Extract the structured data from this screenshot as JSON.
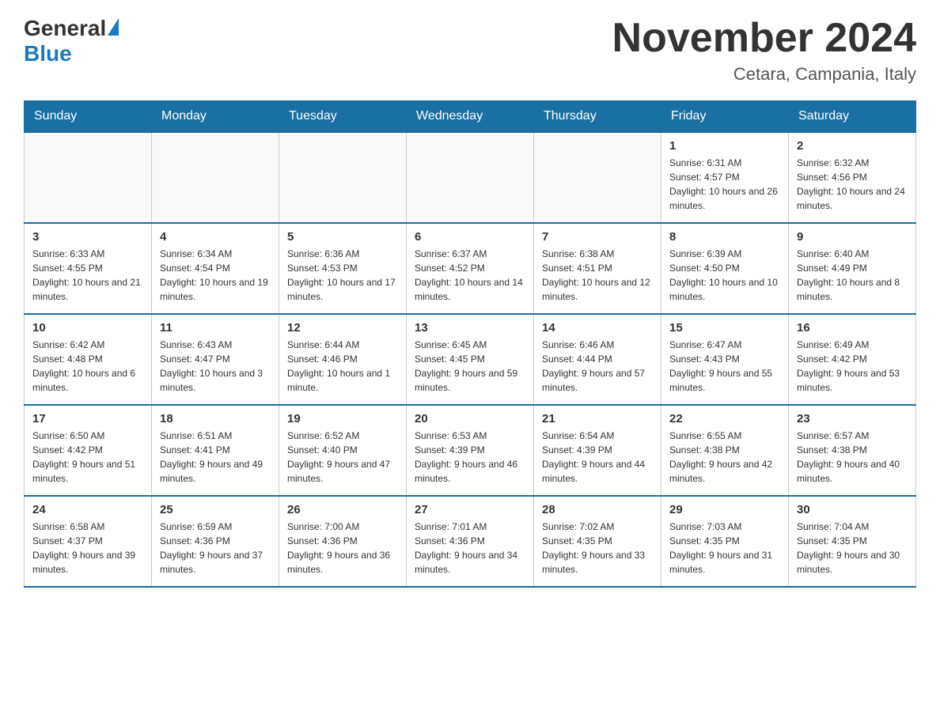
{
  "header": {
    "logo_general": "General",
    "logo_blue": "Blue",
    "month_title": "November 2024",
    "location": "Cetara, Campania, Italy"
  },
  "days_of_week": [
    "Sunday",
    "Monday",
    "Tuesday",
    "Wednesday",
    "Thursday",
    "Friday",
    "Saturday"
  ],
  "weeks": [
    [
      {
        "day": "",
        "info": ""
      },
      {
        "day": "",
        "info": ""
      },
      {
        "day": "",
        "info": ""
      },
      {
        "day": "",
        "info": ""
      },
      {
        "day": "",
        "info": ""
      },
      {
        "day": "1",
        "info": "Sunrise: 6:31 AM\nSunset: 4:57 PM\nDaylight: 10 hours and 26 minutes."
      },
      {
        "day": "2",
        "info": "Sunrise: 6:32 AM\nSunset: 4:56 PM\nDaylight: 10 hours and 24 minutes."
      }
    ],
    [
      {
        "day": "3",
        "info": "Sunrise: 6:33 AM\nSunset: 4:55 PM\nDaylight: 10 hours and 21 minutes."
      },
      {
        "day": "4",
        "info": "Sunrise: 6:34 AM\nSunset: 4:54 PM\nDaylight: 10 hours and 19 minutes."
      },
      {
        "day": "5",
        "info": "Sunrise: 6:36 AM\nSunset: 4:53 PM\nDaylight: 10 hours and 17 minutes."
      },
      {
        "day": "6",
        "info": "Sunrise: 6:37 AM\nSunset: 4:52 PM\nDaylight: 10 hours and 14 minutes."
      },
      {
        "day": "7",
        "info": "Sunrise: 6:38 AM\nSunset: 4:51 PM\nDaylight: 10 hours and 12 minutes."
      },
      {
        "day": "8",
        "info": "Sunrise: 6:39 AM\nSunset: 4:50 PM\nDaylight: 10 hours and 10 minutes."
      },
      {
        "day": "9",
        "info": "Sunrise: 6:40 AM\nSunset: 4:49 PM\nDaylight: 10 hours and 8 minutes."
      }
    ],
    [
      {
        "day": "10",
        "info": "Sunrise: 6:42 AM\nSunset: 4:48 PM\nDaylight: 10 hours and 6 minutes."
      },
      {
        "day": "11",
        "info": "Sunrise: 6:43 AM\nSunset: 4:47 PM\nDaylight: 10 hours and 3 minutes."
      },
      {
        "day": "12",
        "info": "Sunrise: 6:44 AM\nSunset: 4:46 PM\nDaylight: 10 hours and 1 minute."
      },
      {
        "day": "13",
        "info": "Sunrise: 6:45 AM\nSunset: 4:45 PM\nDaylight: 9 hours and 59 minutes."
      },
      {
        "day": "14",
        "info": "Sunrise: 6:46 AM\nSunset: 4:44 PM\nDaylight: 9 hours and 57 minutes."
      },
      {
        "day": "15",
        "info": "Sunrise: 6:47 AM\nSunset: 4:43 PM\nDaylight: 9 hours and 55 minutes."
      },
      {
        "day": "16",
        "info": "Sunrise: 6:49 AM\nSunset: 4:42 PM\nDaylight: 9 hours and 53 minutes."
      }
    ],
    [
      {
        "day": "17",
        "info": "Sunrise: 6:50 AM\nSunset: 4:42 PM\nDaylight: 9 hours and 51 minutes."
      },
      {
        "day": "18",
        "info": "Sunrise: 6:51 AM\nSunset: 4:41 PM\nDaylight: 9 hours and 49 minutes."
      },
      {
        "day": "19",
        "info": "Sunrise: 6:52 AM\nSunset: 4:40 PM\nDaylight: 9 hours and 47 minutes."
      },
      {
        "day": "20",
        "info": "Sunrise: 6:53 AM\nSunset: 4:39 PM\nDaylight: 9 hours and 46 minutes."
      },
      {
        "day": "21",
        "info": "Sunrise: 6:54 AM\nSunset: 4:39 PM\nDaylight: 9 hours and 44 minutes."
      },
      {
        "day": "22",
        "info": "Sunrise: 6:55 AM\nSunset: 4:38 PM\nDaylight: 9 hours and 42 minutes."
      },
      {
        "day": "23",
        "info": "Sunrise: 6:57 AM\nSunset: 4:38 PM\nDaylight: 9 hours and 40 minutes."
      }
    ],
    [
      {
        "day": "24",
        "info": "Sunrise: 6:58 AM\nSunset: 4:37 PM\nDaylight: 9 hours and 39 minutes."
      },
      {
        "day": "25",
        "info": "Sunrise: 6:59 AM\nSunset: 4:36 PM\nDaylight: 9 hours and 37 minutes."
      },
      {
        "day": "26",
        "info": "Sunrise: 7:00 AM\nSunset: 4:36 PM\nDaylight: 9 hours and 36 minutes."
      },
      {
        "day": "27",
        "info": "Sunrise: 7:01 AM\nSunset: 4:36 PM\nDaylight: 9 hours and 34 minutes."
      },
      {
        "day": "28",
        "info": "Sunrise: 7:02 AM\nSunset: 4:35 PM\nDaylight: 9 hours and 33 minutes."
      },
      {
        "day": "29",
        "info": "Sunrise: 7:03 AM\nSunset: 4:35 PM\nDaylight: 9 hours and 31 minutes."
      },
      {
        "day": "30",
        "info": "Sunrise: 7:04 AM\nSunset: 4:35 PM\nDaylight: 9 hours and 30 minutes."
      }
    ]
  ]
}
